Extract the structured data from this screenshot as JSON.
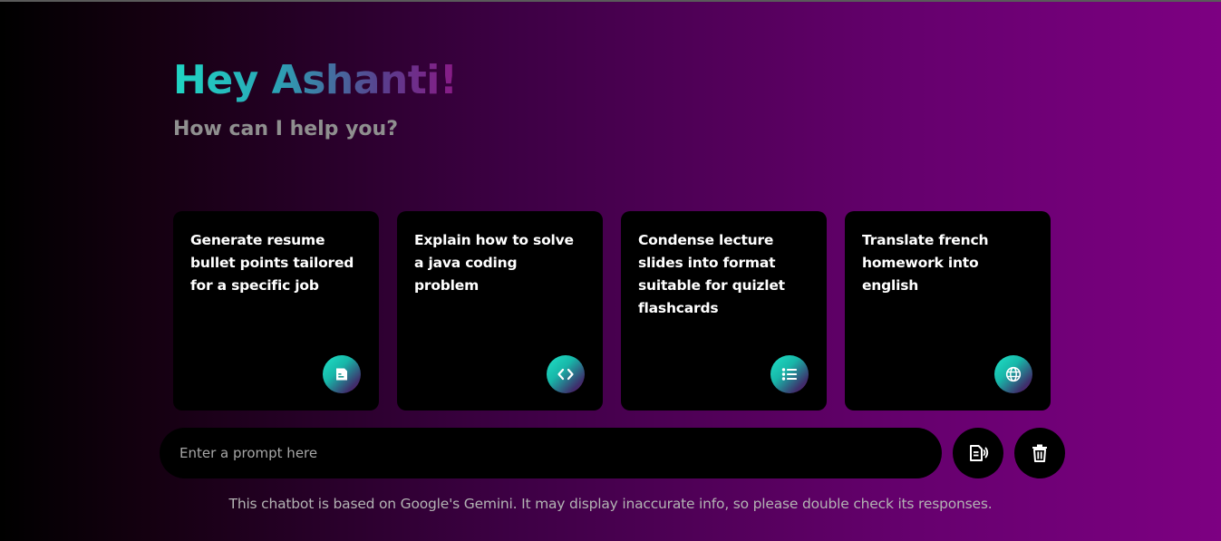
{
  "header": {
    "greeting": "Hey Ashanti!",
    "subtitle": "How can I help you?"
  },
  "suggestions": [
    {
      "text": "Generate resume bullet points tailored for a specific job",
      "icon": "document-icon"
    },
    {
      "text": "Explain how to solve a java coding problem",
      "icon": "code-icon"
    },
    {
      "text": "Condense lecture slides into format suitable for quizlet flashcards",
      "icon": "list-icon"
    },
    {
      "text": "Translate french homework into english",
      "icon": "globe-icon"
    }
  ],
  "prompt": {
    "placeholder": "Enter a prompt here",
    "value": ""
  },
  "buttons": {
    "voice": "speech-to-text-icon",
    "delete": "trash-icon"
  },
  "disclaimer": "This chatbot is based on Google's Gemini. It may display inaccurate info, so please double check its responses.",
  "colors": {
    "accent_teal": "#1fd6c4",
    "accent_purple": "#8a1a86",
    "background_end": "#7d0082",
    "card_background": "#000000"
  }
}
